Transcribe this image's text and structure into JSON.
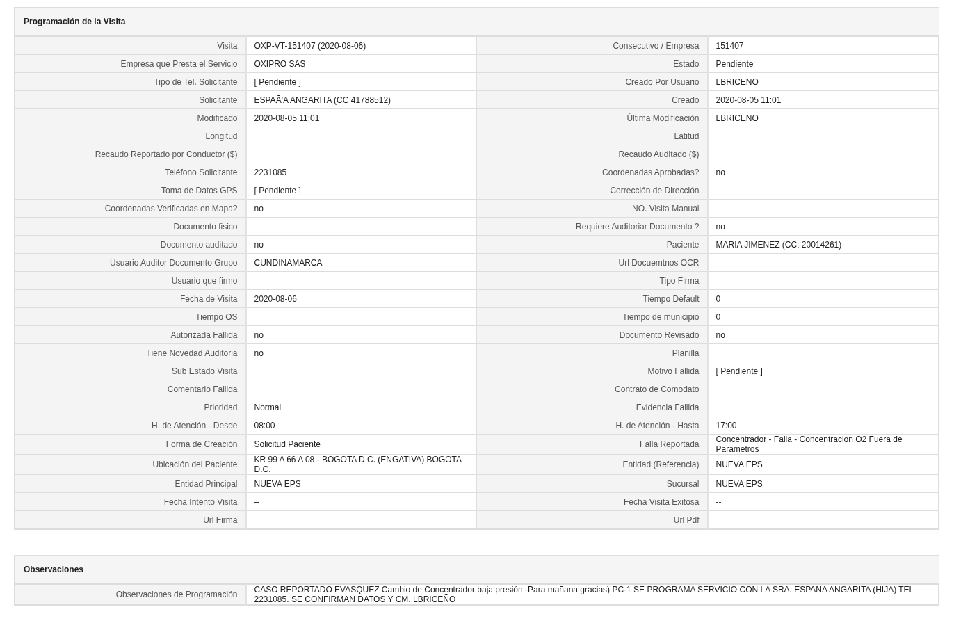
{
  "sections": [
    {
      "title": "Programación de la Visita",
      "rows": [
        {
          "fields": [
            {
              "label": "Visita",
              "value": "OXP-VT-151407 (2020-08-06)"
            },
            {
              "label": "Consecutivo / Empresa",
              "value": "151407"
            }
          ]
        },
        {
          "fields": [
            {
              "label": "Empresa que Presta el Servicio",
              "value": "OXIPRO SAS"
            },
            {
              "label": "Estado",
              "value": "Pendiente"
            }
          ]
        },
        {
          "fields": [
            {
              "label": "Tipo de Tel. Solicitante",
              "value": "[ Pendiente ]"
            },
            {
              "label": "Creado Por Usuario",
              "value": "LBRICENO"
            }
          ]
        },
        {
          "fields": [
            {
              "label": "Solicitante",
              "value": "ESPAÃ'A ANGARITA (CC 41788512)"
            },
            {
              "label": "Creado",
              "value": "2020-08-05 11:01"
            }
          ]
        },
        {
          "fields": [
            {
              "label": "Modificado",
              "value": "2020-08-05 11:01"
            },
            {
              "label": "Última Modificación",
              "value": "LBRICENO"
            }
          ]
        },
        {
          "fields": [
            {
              "label": "Longitud"
            },
            {
              "label": "Latitud"
            }
          ]
        },
        {
          "fields": [
            {
              "label": "Recaudo Reportado por Conductor ($)"
            },
            {
              "label": "Recaudo Auditado ($)"
            }
          ]
        },
        {
          "fields": [
            {
              "label": "Teléfono Solicitante",
              "value": "2231085"
            },
            {
              "label": "Coordenadas Aprobadas?",
              "value": "no"
            }
          ]
        },
        {
          "fields": [
            {
              "label": "Toma de Datos GPS",
              "value": "[ Pendiente ]"
            },
            {
              "label": "Corrección de Dirección"
            }
          ]
        },
        {
          "fields": [
            {
              "label": "Coordenadas Verificadas en Mapa?",
              "value": "no"
            },
            {
              "label": "NO. Visita Manual"
            }
          ]
        },
        {
          "fields": [
            {
              "label": "Documento fisico"
            },
            {
              "label": "Requiere Auditoriar Documento ?",
              "value": "no"
            }
          ]
        },
        {
          "fields": [
            {
              "label": "Documento auditado",
              "value": "no"
            },
            {
              "label": "Paciente",
              "value": "MARIA JIMENEZ (CC: 20014261)"
            }
          ]
        },
        {
          "fields": [
            {
              "label": "Usuario Auditor Documento Grupo",
              "value": "CUNDINAMARCA"
            },
            {
              "label": "Url Docuemtnos OCR"
            }
          ]
        },
        {
          "fields": [
            {
              "label": "Usuario que firmo"
            },
            {
              "label": "Tipo Firma"
            }
          ]
        },
        {
          "fields": [
            {
              "label": "Fecha de Visita",
              "value": "2020-08-06"
            },
            {
              "label": "Tiempo Default",
              "value": "0"
            }
          ]
        },
        {
          "fields": [
            {
              "label": "Tiempo OS"
            },
            {
              "label": "Tiempo de municipio",
              "value": "0"
            }
          ]
        },
        {
          "fields": [
            {
              "label": "Autorizada Fallida",
              "value": "no"
            },
            {
              "label": "Documento Revisado",
              "value": "no"
            }
          ]
        },
        {
          "fields": [
            {
              "label": "Tiene Novedad Auditoria",
              "value": "no"
            },
            {
              "label": "Planilla"
            }
          ]
        },
        {
          "fields": [
            {
              "label": "Sub Estado Visita"
            },
            {
              "label": "Motivo Fallida",
              "value": "[ Pendiente ]"
            }
          ]
        },
        {
          "fields": [
            {
              "label": "Comentario Fallida"
            },
            {
              "label": "Contrato de Comodato"
            }
          ]
        },
        {
          "fields": [
            {
              "label": "Prioridad",
              "value": "Normal"
            },
            {
              "label": "Evidencia Fallida"
            }
          ]
        },
        {
          "fields": [
            {
              "label": "H. de Atención - Desde",
              "value": "08:00"
            },
            {
              "label": "H. de Atención - Hasta",
              "value": "17:00"
            }
          ]
        },
        {
          "fields": [
            {
              "label": "Forma de Creación",
              "value": "Solicitud Paciente"
            },
            {
              "label": "Falla Reportada",
              "value": "Concentrador - Falla - Concentracion O2 Fuera de Parametros"
            }
          ]
        },
        {
          "fields": [
            {
              "label": "Ubicación del Paciente",
              "value": "KR 99 A 66 A 08 - BOGOTA D.C. (ENGATIVA) BOGOTA D.C."
            },
            {
              "label": "Entidad (Referencia)",
              "value": "NUEVA EPS"
            }
          ]
        },
        {
          "fields": [
            {
              "label": "Entidad Principal",
              "value": "NUEVA EPS"
            },
            {
              "label": "Sucursal",
              "value": "NUEVA EPS"
            }
          ]
        },
        {
          "fields": [
            {
              "label": "Fecha Intento Visita",
              "value": "--"
            },
            {
              "label": "Fecha Visita Exitosa",
              "value": "--"
            }
          ]
        },
        {
          "fields": [
            {
              "label": "Url Firma"
            },
            {
              "label": "Url Pdf"
            }
          ]
        }
      ]
    },
    {
      "title": "Observaciones",
      "rows": [
        {
          "fields": [
            {
              "label": "Observaciones de Programación",
              "value": "CASO REPORTADO EVASQUEZ Cambio de Concentrador baja presión -Para mañana gracias) PC-1 SE PROGRAMA SERVICIO CON LA SRA. ESPAÑA ANGARITA (HIJA) TEL 2231085. SE CONFIRMAN DATOS Y CM. LBRICEÑO"
            }
          ]
        }
      ]
    }
  ]
}
